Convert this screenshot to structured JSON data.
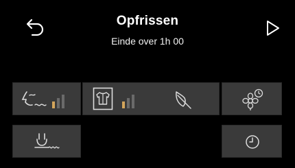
{
  "header": {
    "title": "Opfrissen",
    "subtitle": "Einde over 1h 00"
  },
  "icons": {
    "back": "back-arrow-icon",
    "start": "play-icon",
    "intensity": "scent-intensity-icon",
    "garment": "shirt-icon",
    "delicate": "feather-icon",
    "aroma": "flower-timer-icon",
    "steam": "steam-icon",
    "timer": "clock-icon"
  },
  "levels": {
    "intensity_active_bars": 1,
    "garment_active_bars": 1,
    "total_bars": 3
  },
  "colors": {
    "background": "#000000",
    "tile": "#3a3a3a",
    "level_on": "#d3a55b",
    "level_off": "#6a6a6a"
  }
}
